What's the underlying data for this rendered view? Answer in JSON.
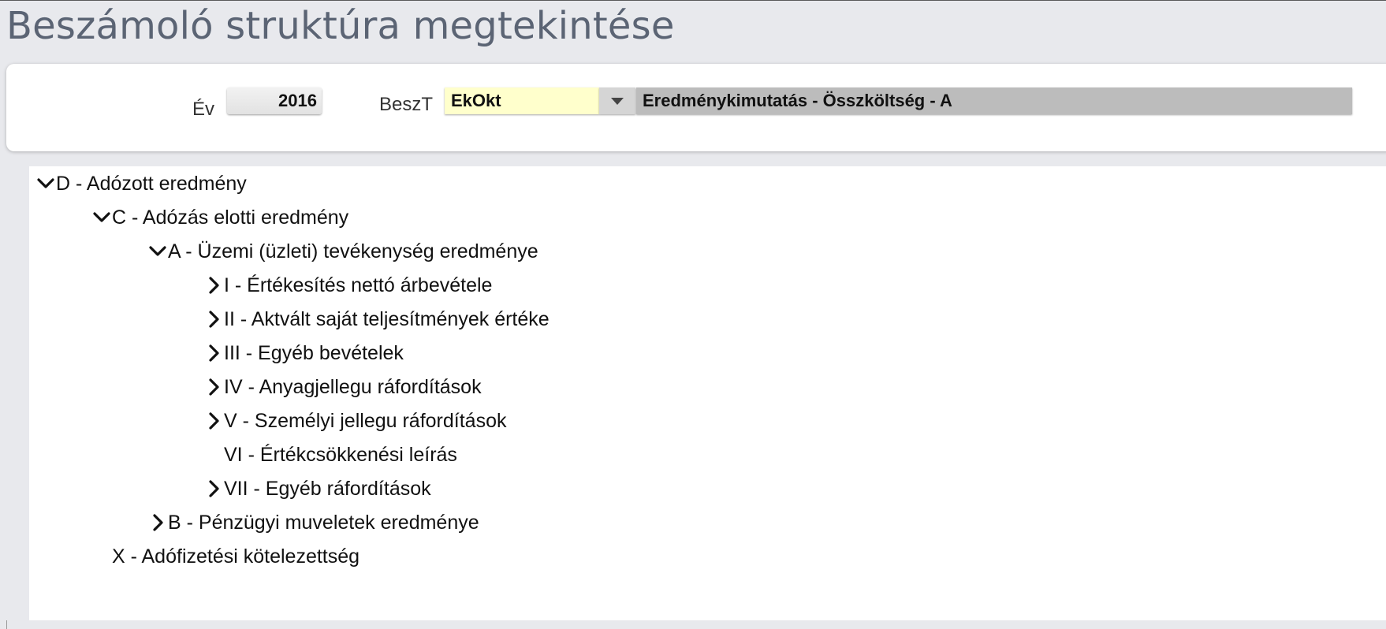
{
  "page": {
    "title": "Beszámoló struktúra megtekintése"
  },
  "filters": {
    "year_label": "Év",
    "year_value": "2016",
    "type_label": "BeszT",
    "type_code": "EkOkt",
    "type_description": "Eredménykimutatás - Összköltség - A"
  },
  "colors": {
    "title_text": "#5b6474",
    "code_field_bg": "#ffffcc",
    "description_field_bg": "#bcbcbc",
    "page_bg": "#e8e9ed"
  },
  "tree": {
    "nodes": [
      {
        "label": "D - Adózott eredmény",
        "level": 0,
        "state": "expanded"
      },
      {
        "label": "C - Adózás elotti eredmény",
        "level": 1,
        "state": "expanded"
      },
      {
        "label": "A - Üzemi (üzleti) tevékenység eredménye",
        "level": 2,
        "state": "expanded"
      },
      {
        "label": "I - Értékesítés nettó árbevétele",
        "level": 3,
        "state": "collapsed"
      },
      {
        "label": "II - Aktvált saját teljesítmények értéke",
        "level": 3,
        "state": "collapsed"
      },
      {
        "label": "III - Egyéb bevételek",
        "level": 3,
        "state": "collapsed"
      },
      {
        "label": "IV - Anyagjellegu ráfordítások",
        "level": 3,
        "state": "collapsed"
      },
      {
        "label": "V - Személyi jellegu ráfordítások",
        "level": 3,
        "state": "collapsed"
      },
      {
        "label": "VI - Értékcsökkenési leírás",
        "level": 3,
        "state": "leaf"
      },
      {
        "label": "VII - Egyéb ráfordítások",
        "level": 3,
        "state": "collapsed"
      },
      {
        "label": "B - Pénzügyi muveletek eredménye",
        "level": 2,
        "state": "collapsed"
      },
      {
        "label": "X - Adófizetési kötelezettség",
        "level": 1,
        "state": "leaf"
      }
    ]
  }
}
